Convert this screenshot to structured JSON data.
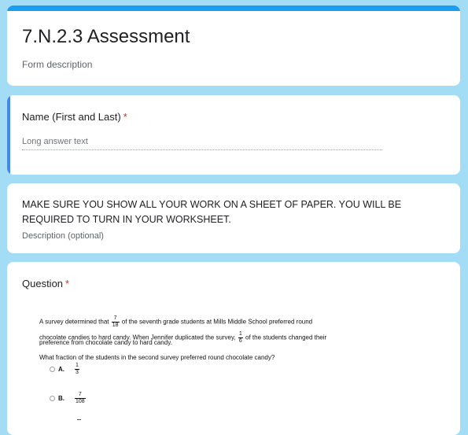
{
  "form": {
    "title": "7.N.2.3 Assessment",
    "description": "Form description"
  },
  "name_question": {
    "label": "Name (First and Last)",
    "required_mark": "*",
    "placeholder": "Long answer text"
  },
  "instructions": {
    "text": "MAKE SURE YOU SHOW ALL YOUR WORK ON A SHEET OF PAPER. YOU WILL BE REQUIRED TO TURN IN YOUR WORKSHEET.",
    "description": "Description (optional)"
  },
  "question": {
    "label": "Question",
    "required_mark": "*",
    "line1_a": "A survey determined that",
    "frac1_num": "7",
    "frac1_den": "18",
    "line1_b": "of the seventh grade students at Mills Middle School preferred round",
    "line2_a": "chocolate candies to hard candy. When Jennifer duplicated the survey,",
    "frac2_num": "1",
    "frac2_den": "6",
    "line2_b": "of the students changed their",
    "line3": "preference from chocolate candy to hard candy.",
    "line4": "What fraction of the students in the second survey preferred round chocolate candy?",
    "choices": [
      {
        "letter": "A.",
        "num": "1",
        "den": "3"
      },
      {
        "letter": "B.",
        "num": "7",
        "den": "108"
      }
    ]
  },
  "colors": {
    "background": "#a2dcf5",
    "accent_bar": "#1a9cf0",
    "active_bar": "#4285f4",
    "required": "#d93025"
  }
}
